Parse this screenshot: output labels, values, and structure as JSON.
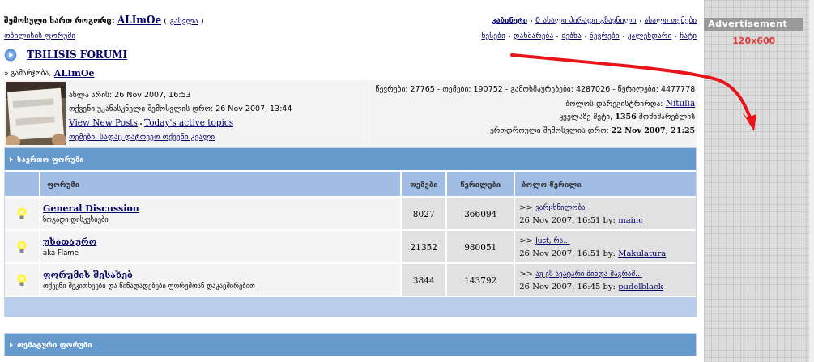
{
  "header": {
    "logged_in_label": "შემოსული ხართ როგორც:",
    "username": "ALImOe",
    "paren_open": "(",
    "logout": "გასვლა",
    "paren_close": ")",
    "breadcrumb": "თბილისის ფორუმი"
  },
  "user_links": [
    {
      "label": "კაბინეტი",
      "primary": true
    },
    {
      "label": "0 ახალი პირადი გზავნილი",
      "primary": false
    },
    {
      "label": "ახალი თემები",
      "primary": false
    }
  ],
  "site_links": [
    "წესები",
    "დახმარება",
    "ძებნა",
    "წევრები",
    "კალენდარი",
    "ჩატი"
  ],
  "forum_title": "TBILISIS FORUMI",
  "welcome": {
    "prefix": "» გამარჯობა,",
    "username": "ALImOe"
  },
  "info": {
    "now": "ახლა არის: 26 Nov 2007, 16:53",
    "last_visit": "თქვენი უკანასკნელი შემოსვლის დრო: 26 Nov 2007, 13:44",
    "links": [
      "View New Posts",
      "Today's active topics"
    ],
    "my_topics": "თემები, სადაც დატოვეთ თქვენი კვალი"
  },
  "stats": {
    "totals": "წევრები: 27765 - თემები: 190752 - გამოხმაურებები: 4287026 - წერილები: 4477778",
    "newest_label": "ბოლოს დარეგისტრირდა:",
    "newest_user": "Nitulia",
    "record": "ყველაზე მეტი, **1356** მომხმარებლის",
    "record_time": "ერთდროული შემოსვლის დრო: **22 Nov 2007, 21:25**"
  },
  "categories": [
    {
      "title": "საერთო ფორუმი",
      "columns": [
        "ფორუმი",
        "თემები",
        "წერილები",
        "ბოლო წერილი"
      ],
      "forums": [
        {
          "name": "General Discussion",
          "description": "ზოგადი დისკუსიები",
          "topics": "8027",
          "posts": "366094",
          "last_prefix": ">>",
          "last_title": "ვარცხნილობა",
          "last_time": "26 Nov 2007, 16:51 by:",
          "last_user": "mainc"
        },
        {
          "name": "უხათაურო",
          "description": "aka Flame",
          "topics": "21352",
          "posts": "980051",
          "last_prefix": ">>",
          "last_title": "Just, რა...",
          "last_time": "26 Nov 2007, 16:51 by:",
          "last_user": "Makulatura"
        },
        {
          "name": "ფორუმის შესახებ",
          "description": "თქვენი შეკითხვები და წინადადებები ფორუმთან დაკავშირებით",
          "topics": "3844",
          "posts": "143792",
          "last_prefix": ">>",
          "last_title": "აუ ეს ავატარი მინდა მაგრამ...",
          "last_time": "26 Nov 2007, 16:45 by:",
          "last_user": "pudelblack"
        }
      ]
    },
    {
      "title": "თემატური ფორუმი"
    }
  ],
  "ad": {
    "title": "Advertisement",
    "size": "120x600"
  }
}
